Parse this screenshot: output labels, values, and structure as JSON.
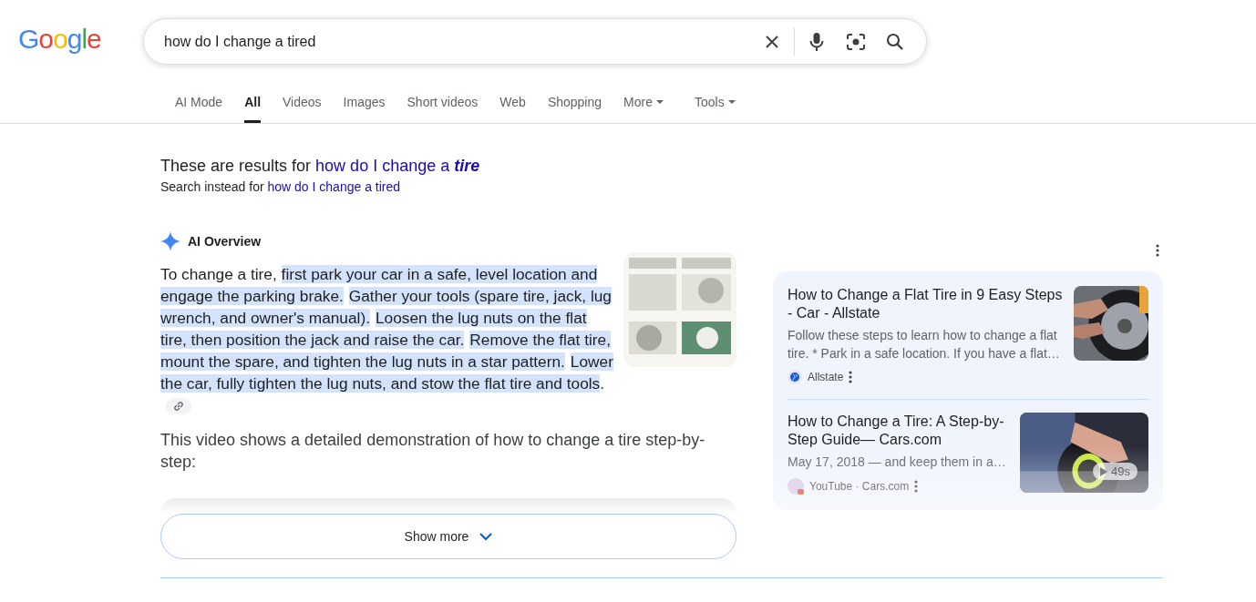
{
  "logo": "Google",
  "search": {
    "value": "how do I change a tired"
  },
  "tabs": [
    {
      "label": "AI Mode",
      "selected": false,
      "kind": "plain"
    },
    {
      "label": "All",
      "selected": true,
      "kind": "plain"
    },
    {
      "label": "Videos",
      "selected": false,
      "kind": "plain"
    },
    {
      "label": "Images",
      "selected": false,
      "kind": "plain"
    },
    {
      "label": "Short videos",
      "selected": false,
      "kind": "plain"
    },
    {
      "label": "Web",
      "selected": false,
      "kind": "plain"
    },
    {
      "label": "Shopping",
      "selected": false,
      "kind": "plain"
    },
    {
      "label": "More",
      "selected": false,
      "kind": "menu"
    },
    {
      "label": "Tools",
      "selected": false,
      "kind": "menu"
    }
  ],
  "correction": {
    "prefix": "These are results for",
    "query": "how do I change a *tire*",
    "instead_prefix": "Search instead for",
    "instead_query": "how do I change a tired"
  },
  "ai_overview": {
    "title": "AI Overview",
    "segments": [
      {
        "text": "To change a tire, ",
        "highlighted": false
      },
      {
        "text": "first park your car in a safe, level location and engage the parking brake.",
        "highlighted": true
      },
      {
        "text": "Gather your tools (spare tire, jack, lug wrench, and owner's manual).",
        "highlighted": true
      },
      {
        "text": "Loosen the lug nuts on the flat tire, then position the jack and raise the car.",
        "highlighted": true
      },
      {
        "text": "Remove the flat tire, mount the spare, and tighten the lug nuts in a star pattern.",
        "highlighted": true
      },
      {
        "text": "Lower the car, fully tighten the lug nuts, and stow the flat tire and tools",
        "highlighted": true
      },
      {
        "text": ".",
        "highlighted": false
      }
    ],
    "video_text": "This video shows a detailed demonstration of how to change a tire step-by-step:",
    "show_more": "Show more"
  },
  "sources": [
    {
      "title": "How to Change a Flat Tire in 9 Easy Steps - Car - Allstate",
      "snippet": "Follow these steps to learn how to change a flat tire. * Park in a safe location. If you have a flat…",
      "source": "Allstate",
      "kind": "page"
    },
    {
      "title": "How to Change a Tire: A Step-by-Step Guide— Cars.com",
      "snippet": "May 17, 2018 — and keep them in a…",
      "source": "YouTube · Cars.com",
      "kind": "video",
      "duration": "49s"
    }
  ]
}
